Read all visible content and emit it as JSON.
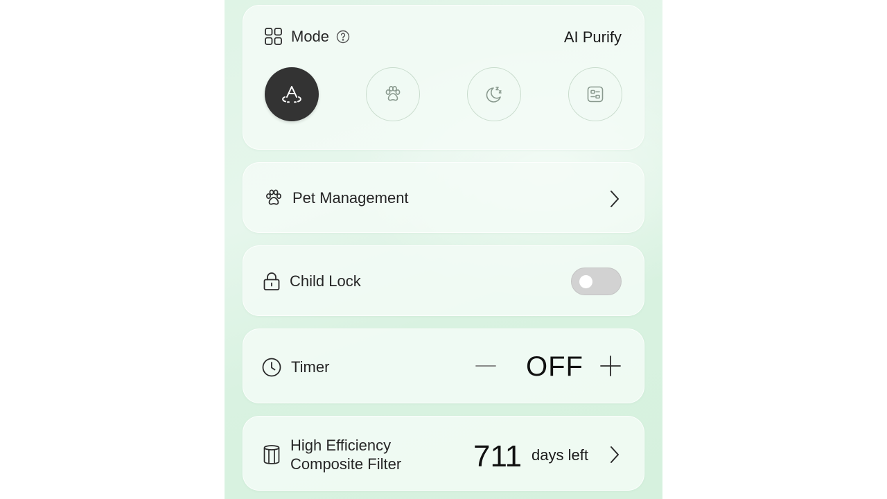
{
  "mode": {
    "title": "Mode",
    "current": "AI Purify",
    "buttons": [
      {
        "name": "ai-purify",
        "icon": "ai-purify-icon",
        "active": true
      },
      {
        "name": "pet",
        "icon": "paw-icon",
        "active": false
      },
      {
        "name": "sleep",
        "icon": "moon-sleep-icon",
        "active": false
      },
      {
        "name": "custom",
        "icon": "custom-settings-icon",
        "active": false
      }
    ]
  },
  "pet": {
    "label": "Pet Management"
  },
  "child_lock": {
    "label": "Child Lock",
    "enabled": false
  },
  "timer": {
    "label": "Timer",
    "value": "OFF"
  },
  "filter": {
    "label_line1": "High Efficiency",
    "label_line2": "Composite Filter",
    "days": "711",
    "days_suffix": "days left"
  },
  "colors": {
    "background": "#dff4e6",
    "card": "#f4fbf6",
    "active_mode": "#333333",
    "toggle_off": "#d2d2d2"
  }
}
